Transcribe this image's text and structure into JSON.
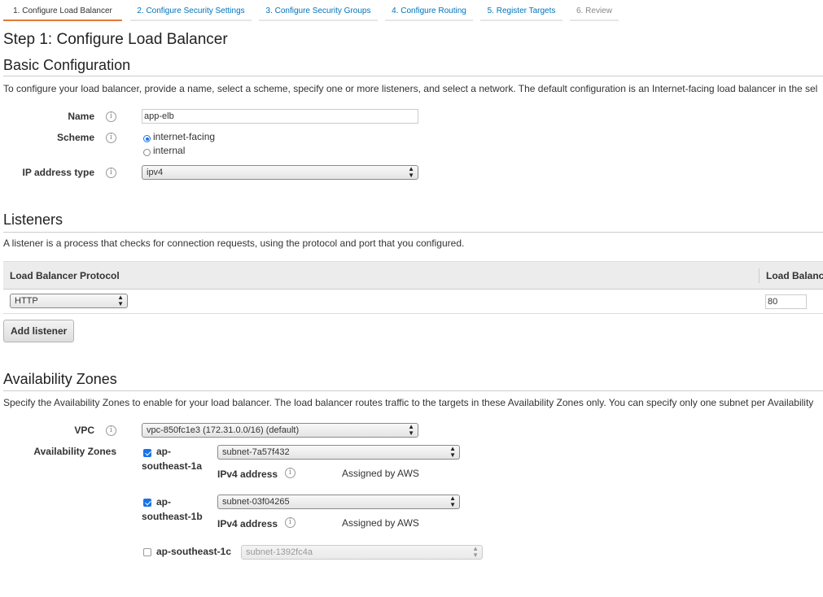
{
  "wizard": {
    "tabs": [
      {
        "label": "1. Configure Load Balancer"
      },
      {
        "label": "2. Configure Security Settings"
      },
      {
        "label": "3. Configure Security Groups"
      },
      {
        "label": "4. Configure Routing"
      },
      {
        "label": "5. Register Targets"
      },
      {
        "label": "6. Review"
      }
    ]
  },
  "page_title": "Step 1: Configure Load Balancer",
  "basic": {
    "heading": "Basic Configuration",
    "description": "To configure your load balancer, provide a name, select a scheme, specify one or more listeners, and select a network. The default configuration is an Internet-facing load balancer in the sel",
    "name_label": "Name",
    "name_value": "app-elb",
    "scheme_label": "Scheme",
    "scheme_options": [
      "internet-facing",
      "internal"
    ],
    "scheme_selected": "internet-facing",
    "ip_label": "IP address type",
    "ip_value": "ipv4"
  },
  "listeners": {
    "heading": "Listeners",
    "description": "A listener is a process that checks for connection requests, using the protocol and port that you configured.",
    "columns": [
      "Load Balancer Protocol",
      "Load Balanc"
    ],
    "rows": [
      {
        "protocol": "HTTP",
        "port": "80"
      }
    ],
    "add_button": "Add listener"
  },
  "az": {
    "heading": "Availability Zones",
    "description": "Specify the Availability Zones to enable for your load balancer. The load balancer routes traffic to the targets in these Availability Zones only. You can specify only one subnet per Availability",
    "vpc_label": "VPC",
    "vpc_value": "vpc-850fc1e3 (172.31.0.0/16) (default)",
    "zones_label": "Availability Zones",
    "zones": [
      {
        "name_line1": "ap-",
        "name_line2": "southeast-1a",
        "checked": true,
        "subnet": "subnet-7a57f432",
        "ipv4_label": "IPv4 address",
        "ipv4_value": "Assigned by AWS"
      },
      {
        "name_line1": "ap-",
        "name_line2": "southeast-1b",
        "checked": true,
        "subnet": "subnet-03f04265",
        "ipv4_label": "IPv4 address",
        "ipv4_value": "Assigned by AWS"
      },
      {
        "name": "ap-southeast-1c",
        "checked": false,
        "subnet": "subnet-1392fc4a"
      }
    ]
  },
  "icons": {
    "info": "info-icon",
    "select_arrows": "updown-arrows-icon",
    "checkbox": "checkbox",
    "radio": "radio"
  },
  "colors": {
    "active_tab_underline": "#e07b39",
    "link": "#0073bb",
    "checkbox_blue": "#1a73e8"
  }
}
